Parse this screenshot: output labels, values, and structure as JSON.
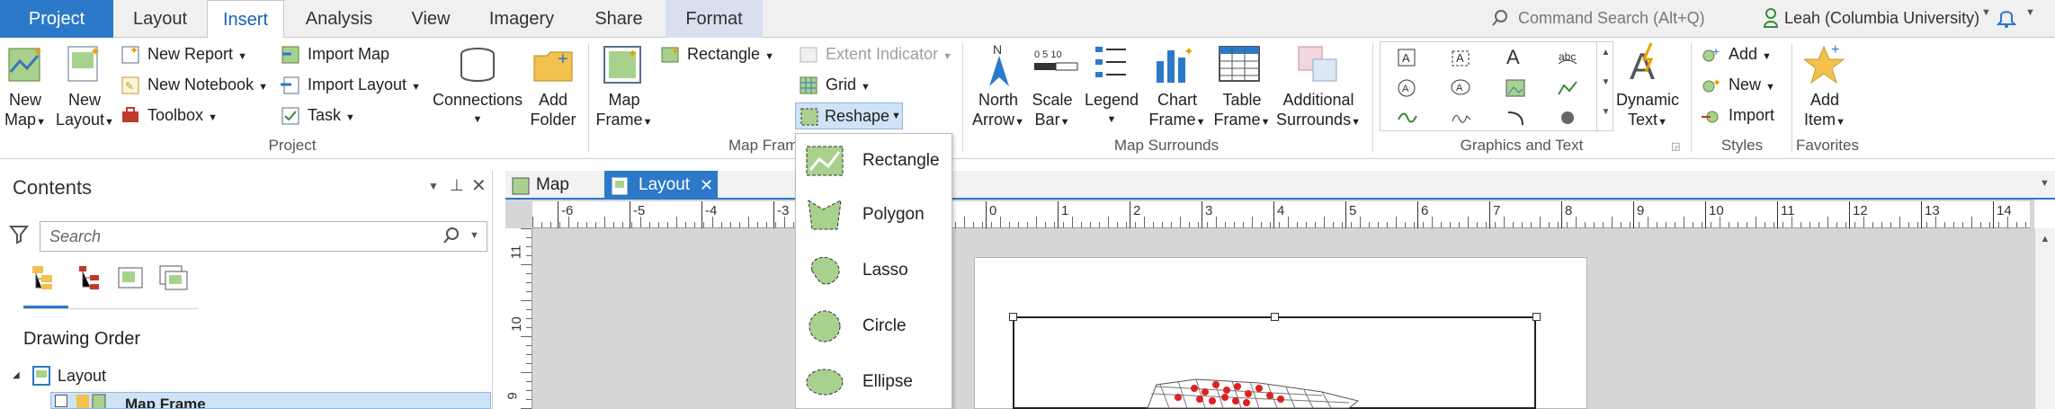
{
  "tabs": [
    {
      "label": "Project"
    },
    {
      "label": "Layout"
    },
    {
      "label": "Insert"
    },
    {
      "label": "Analysis"
    },
    {
      "label": "View"
    },
    {
      "label": "Imagery"
    },
    {
      "label": "Share"
    },
    {
      "label": "Format"
    }
  ],
  "command_search": {
    "placeholder": "Command Search (Alt+Q)"
  },
  "user": {
    "name": "Leah (Columbia University)"
  },
  "project_group": {
    "title": "Project",
    "new_map": [
      "New",
      "Map"
    ],
    "new_layout": [
      "New",
      "Layout"
    ],
    "new_report": "New Report",
    "new_notebook": "New Notebook",
    "toolbox": "Toolbox",
    "import_map": "Import Map",
    "import_layout": "Import Layout",
    "task": "Task",
    "connections": "Connections",
    "add_folder": [
      "Add",
      "Folder"
    ]
  },
  "map_frames_group": {
    "title": "Map Frames",
    "map_frame": [
      "Map",
      "Frame"
    ],
    "rectangle": "Rectangle",
    "extent_indicator": "Extent Indicator",
    "grid": "Grid",
    "reshape": "Reshape"
  },
  "map_surrounds_group": {
    "title": "Map Surrounds",
    "north_arrow": [
      "North",
      "Arrow"
    ],
    "scale_bar": [
      "Scale",
      "Bar"
    ],
    "legend": "Legend",
    "chart_frame": [
      "Chart",
      "Frame"
    ],
    "table_frame": [
      "Table",
      "Frame"
    ],
    "additional_surrounds": [
      "Additional",
      "Surrounds"
    ],
    "scale_ticks": "0 5 10",
    "north_letter": "N"
  },
  "graphics_text_group": {
    "title": "Graphics and Text",
    "dynamic_text": [
      "Dynamic",
      "Text"
    ]
  },
  "styles_group": {
    "title": "Styles",
    "add": "Add",
    "new": "New",
    "import": "Import"
  },
  "favorites_group": {
    "title": "Favorites",
    "add_item": [
      "Add",
      "Item"
    ]
  },
  "reshape_menu": {
    "items": [
      {
        "label": "Rectangle"
      },
      {
        "label": "Polygon"
      },
      {
        "label": "Lasso"
      },
      {
        "label": "Circle"
      },
      {
        "label": "Ellipse"
      }
    ]
  },
  "contents": {
    "title": "Contents",
    "search_placeholder": "Search",
    "drawing_order": "Drawing Order",
    "layout_item": "Layout",
    "map_frame_item": "Map Frame"
  },
  "doc_tabs": [
    {
      "label": "Map"
    },
    {
      "label": "Layout"
    }
  ],
  "ruler_h": [
    "-6",
    "-5",
    "-4",
    "-3",
    "0",
    "1",
    "2",
    "3",
    "4",
    "5",
    "6",
    "7",
    "8",
    "9",
    "10",
    "11",
    "12",
    "13",
    "14"
  ],
  "ruler_v": [
    "11",
    "10",
    "9"
  ],
  "colors": {
    "accent": "#2b79c8",
    "format_tab": "#d8dfef",
    "dropdown_hover": "#cfe3f7"
  }
}
